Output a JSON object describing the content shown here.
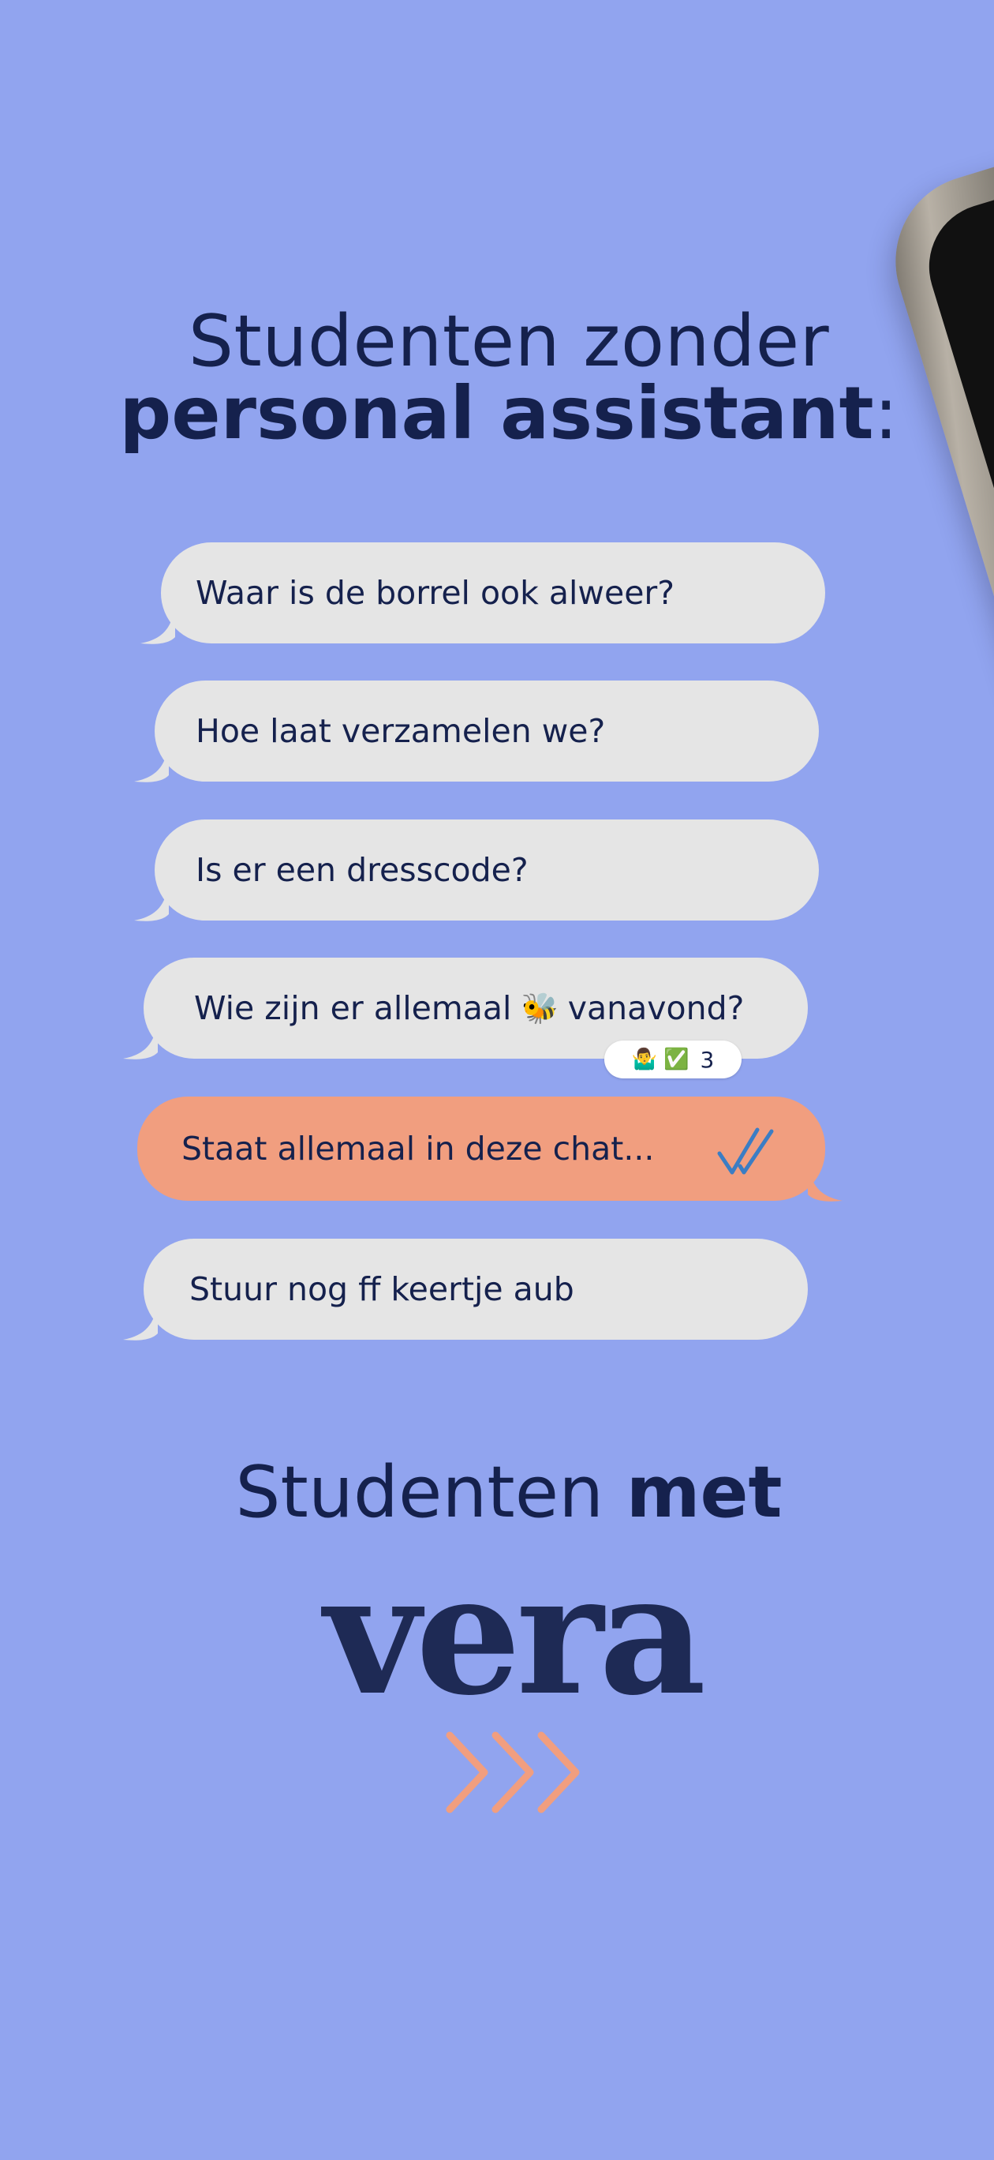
{
  "headline": {
    "line1": "Studenten zonder",
    "line2_bold": "personal assistant",
    "line2_suffix": ":"
  },
  "messages": [
    {
      "text": "Waar is de borrel ook alweer?",
      "sender": "incoming"
    },
    {
      "text": "Hoe laat verzamelen we?",
      "sender": "incoming"
    },
    {
      "text": "Is er een dresscode?",
      "sender": "incoming"
    },
    {
      "text": "Wie zijn er allemaal",
      "emoji": "🐝",
      "text_after": "vanavond?",
      "sender": "incoming"
    },
    {
      "text": "Staat allemaal in deze chat...",
      "sender": "outgoing",
      "status": "double-check-icon"
    },
    {
      "text": "Stuur nog ff keertje aub",
      "sender": "incoming"
    }
  ],
  "reaction": {
    "emoji_1": "🤷‍♂️",
    "emoji_2": "✅",
    "count": "3"
  },
  "footer": {
    "line1_regular": "Studenten",
    "line1_bold": "met",
    "brand": "vera",
    "arrows": "triple-chevron-right-icon"
  },
  "colors": {
    "background": "#91a4ef",
    "incoming_bubble": "#e5e5e5",
    "outgoing_bubble": "#f19e7f",
    "text": "#15214d",
    "check_marks": "#3b7dc4",
    "chevrons": "#f19e7f"
  }
}
